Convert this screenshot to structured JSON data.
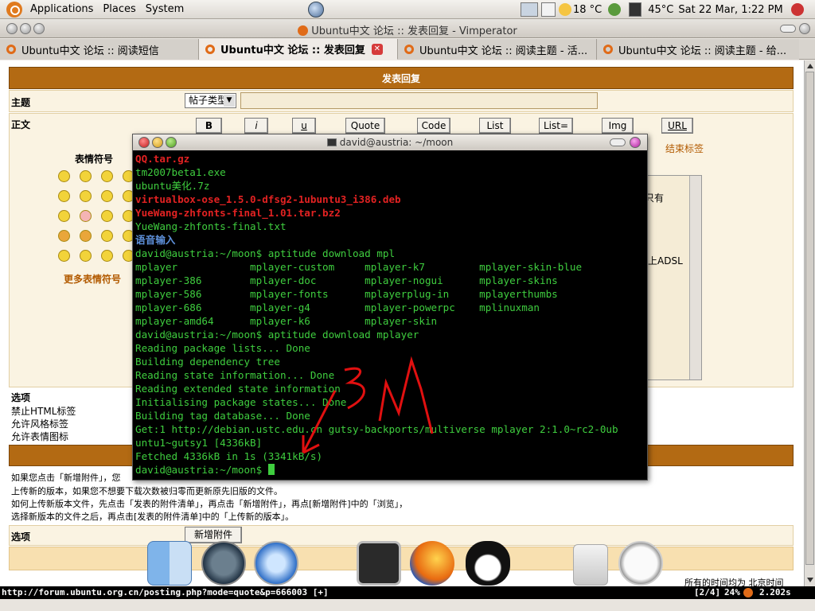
{
  "panel": {
    "applications": "Applications",
    "places": "Places",
    "system": "System",
    "temperature": "18 °C",
    "cpu_temp": "45°C",
    "datetime": "Sat 22 Mar,  1:22 PM"
  },
  "window": {
    "title": "Ubuntu中文 论坛 :: 发表回复 - Vimperator"
  },
  "tabs": [
    {
      "label": "Ubuntu中文 论坛 :: 阅读短信"
    },
    {
      "label": "Ubuntu中文 论坛 :: 发表回复"
    },
    {
      "label": "Ubuntu中文 论坛 :: 阅读主题 - 活..."
    },
    {
      "label": "Ubuntu中文 论坛 :: 阅读主题 - 给..."
    }
  ],
  "page": {
    "header": "发表回复",
    "subject_label": "主题",
    "topic_type": "帖子类型",
    "body_label": "正文",
    "smilies_title": "表情符号",
    "more_smilies": "更多表情符号",
    "close_tags": "结束标签",
    "sidebar_text_1": "只有",
    "sidebar_text_2": "上ADSL",
    "options_title": "选项",
    "option_html": "禁止HTML标签",
    "option_bbcode": "允许风格标签",
    "option_smilies": "允许表情图标",
    "attach_line1": "如果您点击「新增附件」，您",
    "attach_line2": "上传新的版本，如果您不想要下载次数被归零而更新原先旧版的文件。",
    "attach_line3": "如何上传新版本文件，先点击「发表的附件清单」，再点击「新增附件」，再点[新增附件]中的「浏览」，",
    "attach_line4": "选择新版本的文件之后，再点击[发表的附件清单]中的「上传新的版本」。",
    "options_label_2": "选项",
    "add_attachment": "新增附件",
    "timezone": "所有的时间均为 北京时间"
  },
  "format_buttons": [
    "B",
    "i",
    "u",
    "Quote",
    "Code",
    "List",
    "List=",
    "Img",
    "URL"
  ],
  "terminal": {
    "title": "david@austria: ~/moon",
    "lines": [
      {
        "t": "QQ.tar.gz",
        "c": "r"
      },
      {
        "t": "tm2007beta1.exe",
        "c": "g"
      },
      {
        "t": "ubuntu美化.7z",
        "c": "g"
      },
      {
        "t": "virtualbox-ose_1.5.0-dfsg2-1ubuntu3_i386.deb",
        "c": "r"
      },
      {
        "t": "YueWang-zhfonts-final_1.01.tar.bz2",
        "c": "r"
      },
      {
        "t": "YueWang-zhfonts-final.txt",
        "c": "g"
      },
      {
        "t": "语音输入",
        "c": "b"
      },
      {
        "t": "david@austria:~/moon$ aptitude download mpl",
        "c": "g"
      },
      {
        "t": "mplayer            mplayer-custom     mplayer-k7         mplayer-skin-blue",
        "c": "g"
      },
      {
        "t": "mplayer-386        mplayer-doc        mplayer-nogui      mplayer-skins",
        "c": "g"
      },
      {
        "t": "mplayer-586        mplayer-fonts      mplayerplug-in     mplayerthumbs",
        "c": "g"
      },
      {
        "t": "mplayer-686        mplayer-g4         mplayer-powerpc    mplinuxman",
        "c": "g"
      },
      {
        "t": "mplayer-amd64      mplayer-k6         mplayer-skin",
        "c": "g"
      },
      {
        "t": "david@austria:~/moon$ aptitude download mplayer",
        "c": "g"
      },
      {
        "t": "Reading package lists... Done",
        "c": "g"
      },
      {
        "t": "Building dependency tree",
        "c": "g"
      },
      {
        "t": "Reading state information... Done",
        "c": "g"
      },
      {
        "t": "Reading extended state information",
        "c": "g"
      },
      {
        "t": "Initialising package states... Done",
        "c": "g"
      },
      {
        "t": "Building tag database... Done",
        "c": "g"
      },
      {
        "t": "Get:1 http://debian.ustc.edu.cn gutsy-backports/multiverse mplayer 2:1.0~rc2-0ub",
        "c": "g"
      },
      {
        "t": "untu1~gutsy1 [4336kB]",
        "c": "g"
      },
      {
        "t": "Fetched 4336kB in 1s (3341kB/s)",
        "c": "g"
      },
      {
        "t": "david@austria:~/moon$ ",
        "c": "g"
      }
    ]
  },
  "statusbar": {
    "url": "http://forum.ubuntu.org.cn/posting.php?mode=quote&p=666003 [+]",
    "position": "[2/4]",
    "zoom": "24%",
    "speed": "2.202s"
  }
}
